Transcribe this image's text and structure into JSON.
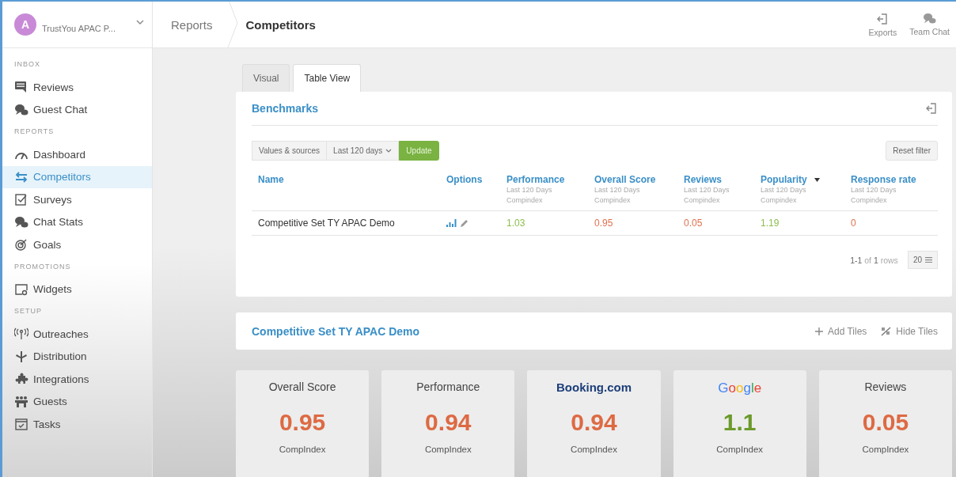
{
  "account": {
    "initial": "A",
    "name": "TrustYou APAC P..."
  },
  "breadcrumb": [
    "Reports",
    "Competitors"
  ],
  "header_actions": [
    {
      "label": "Exports"
    },
    {
      "label": "Team Chat"
    }
  ],
  "sidebar": [
    {
      "heading": "INBOX",
      "items": [
        {
          "label": "Reviews",
          "selected": false
        },
        {
          "label": "Guest Chat",
          "selected": false
        }
      ]
    },
    {
      "heading": "REPORTS",
      "items": [
        {
          "label": "Dashboard",
          "selected": false
        },
        {
          "label": "Competitors",
          "selected": true
        },
        {
          "label": "Surveys",
          "selected": false
        },
        {
          "label": "Chat Stats",
          "selected": false
        },
        {
          "label": "Goals",
          "selected": false
        }
      ]
    },
    {
      "heading": "PROMOTIONS",
      "items": [
        {
          "label": "Widgets",
          "selected": false
        }
      ]
    },
    {
      "heading": "SETUP",
      "items": [
        {
          "label": "Outreaches",
          "selected": false
        },
        {
          "label": "Distribution",
          "selected": false
        },
        {
          "label": "Integrations",
          "selected": false
        },
        {
          "label": "Guests",
          "selected": false
        },
        {
          "label": "Tasks",
          "selected": false
        }
      ]
    }
  ],
  "tabs": [
    {
      "label": "Visual",
      "selected": false
    },
    {
      "label": "Table View",
      "selected": true
    }
  ],
  "benchmarks": {
    "title": "Benchmarks",
    "filters": {
      "values": "Values & sources",
      "period": "Last 120 days",
      "update": "Update",
      "reset": "Reset filter"
    },
    "columns": [
      {
        "label": "Name"
      },
      {
        "label": "Options"
      },
      {
        "label": "Performance",
        "sub1": "Last 120 Days",
        "sub2": "Compindex",
        "sorted": false
      },
      {
        "label": "Overall Score",
        "sub1": "Last 120 Days",
        "sub2": "Compindex",
        "sorted": false
      },
      {
        "label": "Reviews",
        "sub1": "Last 120 Days",
        "sub2": "Compindex",
        "sorted": false
      },
      {
        "label": "Popularity",
        "sub1": "Last 120 Days",
        "sub2": "Compindex",
        "sorted": true
      },
      {
        "label": "Response rate",
        "sub1": "Last 120 Days",
        "sub2": "Compindex",
        "sorted": false
      }
    ],
    "rows": [
      {
        "name": "Competitive Set TY APAC Demo",
        "values": [
          {
            "text": "1.03",
            "color": "#8bbf4f"
          },
          {
            "text": "0.95",
            "color": "#e0714f"
          },
          {
            "text": "0.05",
            "color": "#e0714f"
          },
          {
            "text": "1.19",
            "color": "#8bbf4f"
          },
          {
            "text": "0",
            "color": "#e0714f"
          }
        ]
      }
    ],
    "pagination": {
      "range": "1-1",
      "of": "of",
      "total": "1",
      "unit": "rows",
      "page_size": "20"
    }
  },
  "competitive_set": {
    "title": "Competitive Set TY APAC Demo",
    "actions": [
      {
        "label": "Add Tiles"
      },
      {
        "label": "Hide Tiles"
      }
    ]
  },
  "tiles": [
    {
      "kind": "label",
      "title": "Overall Score",
      "value": "0.95",
      "color": "#dd6a43",
      "unit": "CompIndex"
    },
    {
      "kind": "label",
      "title": "Performance",
      "value": "0.94",
      "color": "#dd6a43",
      "unit": "CompIndex"
    },
    {
      "kind": "booking",
      "title": "Booking.com",
      "value": "0.94",
      "color": "#dd6a43",
      "unit": "CompIndex"
    },
    {
      "kind": "google",
      "title": "Google",
      "value": "1.1",
      "color": "#6c9a2c",
      "unit": "CompIndex"
    },
    {
      "kind": "label",
      "title": "Reviews",
      "value": "0.05",
      "color": "#dd6a43",
      "unit": "CompIndex"
    }
  ]
}
